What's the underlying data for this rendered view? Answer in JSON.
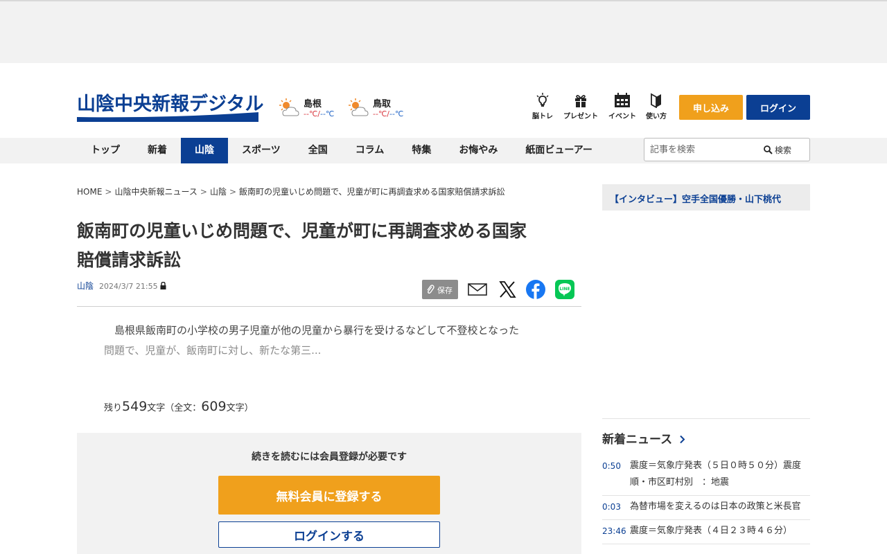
{
  "header": {
    "logo_text": "山陰中央新報デジタル",
    "weather": [
      {
        "city": "島根",
        "high": "--℃",
        "low": "--℃",
        "icon": "sun-cloud-icon"
      },
      {
        "city": "鳥取",
        "high": "--℃",
        "low": "--℃",
        "icon": "sun-cloud-icon"
      }
    ],
    "icons": [
      {
        "label": "脳トレ",
        "icon": "lightbulb-icon"
      },
      {
        "label": "プレゼント",
        "icon": "gift-icon"
      },
      {
        "label": "イベント",
        "icon": "calendar-icon"
      },
      {
        "label": "使い方",
        "icon": "beginner-mark-icon"
      }
    ],
    "apply_label": "申し込み",
    "login_label": "ログイン"
  },
  "nav": {
    "items": [
      "トップ",
      "新着",
      "山陰",
      "スポーツ",
      "全国",
      "コラム",
      "特集",
      "お悔やみ",
      "紙面ビューアー"
    ],
    "active": "山陰",
    "search_placeholder": "記事を検索",
    "search_label": "検索"
  },
  "breadcrumb": [
    "HOME",
    "山陰中央新報ニュース",
    "山陰",
    "飯南町の児童いじめ問題で、児童が町に再調査求める国家賠償請求訴訟"
  ],
  "article": {
    "title_line1": "飯南町の児童いじめ問題で、児童が町に再調査求める国家",
    "title_line2": "賠償請求訴訟",
    "category": "山陰",
    "date": "2024/3/7 21:55",
    "save_label": "保存",
    "lead_line1": "　島根県飯南町の小学校の男子児童が他の児童から暴行を受けるなどして不登校となった",
    "lead_line2": "問題で、児童が、飯南町に対し、新たな第三...",
    "remain_prefix": "残り",
    "remain_count": "549",
    "remain_mid": "文字（全文：",
    "total_count": "609",
    "remain_suffix": "文字）"
  },
  "paywall": {
    "title": "続きを読むには会員登録が必要です",
    "register_label": "無料会員に登録する",
    "login_label": "ログインする"
  },
  "sidebar": {
    "banner": "【インタビュー】空手全国優勝・山下桃代",
    "news_heading": "新着ニュース",
    "news": [
      {
        "time": "0:50",
        "headline": "震度＝気象庁発表（５日０時５０分）震度順・市区町村別　：地震"
      },
      {
        "time": "0:03",
        "headline": "為替市場を変えるのは日本の政策と米長官"
      },
      {
        "time": "23:46",
        "headline": "震度＝気象庁発表（４日２３時４６分）"
      }
    ]
  },
  "colors": {
    "brand": "#0b3f93",
    "accent": "#f0a01c"
  }
}
